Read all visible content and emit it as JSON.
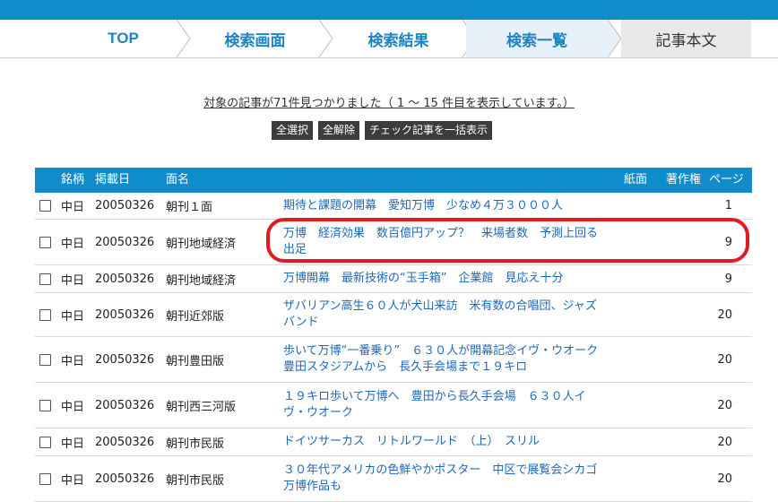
{
  "breadcrumb": {
    "items": [
      {
        "label": "TOP"
      },
      {
        "label": "検索画面"
      },
      {
        "label": "検索結果"
      },
      {
        "label": "検索一覧"
      },
      {
        "label": "記事本文"
      }
    ]
  },
  "summary": {
    "text": "対象の記事が71件見つかりました（ 1 ～ 15 件目を表示しています。）"
  },
  "buttons": {
    "select_all": "全選択",
    "clear_all": "全解除",
    "show_checked": "チェック記事を一括表示"
  },
  "table": {
    "headers": {
      "brand": "銘柄",
      "date": "掲載日",
      "edition": "面名",
      "paper_page": "紙面",
      "copyright": "著作権",
      "page": "ページ"
    },
    "rows": [
      {
        "brand": "中日",
        "date": "20050326",
        "edition": "朝刊１面",
        "title": "期待と課題の開幕　愛知万博　少なめ４万３０００人",
        "page": "1"
      },
      {
        "brand": "中日",
        "date": "20050326",
        "edition": "朝刊地域経済",
        "title": "万博　経済効果　数百億円アップ？　来場者数　予測上回る出足",
        "page": "9"
      },
      {
        "brand": "中日",
        "date": "20050326",
        "edition": "朝刊地域経済",
        "title": "万博開幕　最新技術の“玉手箱”　企業館　見応え十分",
        "page": "9"
      },
      {
        "brand": "中日",
        "date": "20050326",
        "edition": "朝刊近郊版",
        "title": "ザバリアン高生６０人が犬山来訪　米有数の合唱団、ジャズバンド",
        "page": "20"
      },
      {
        "brand": "中日",
        "date": "20050326",
        "edition": "朝刊豊田版",
        "title": "歩いて万博“一番乗り”　６３０人が開幕記念イヴ・ウオーク　豊田スタジアムから　長久手会場まで１９キロ",
        "page": "20"
      },
      {
        "brand": "中日",
        "date": "20050326",
        "edition": "朝刊西三河版",
        "title": "１９キロ歩いて万博へ　豊田から長久手会場　６３０人イヴ・ウオーク",
        "page": "20"
      },
      {
        "brand": "中日",
        "date": "20050326",
        "edition": "朝刊市民版",
        "title": "ドイツサーカス　リトルワールド　（上）　スリル",
        "page": "20"
      },
      {
        "brand": "中日",
        "date": "20050326",
        "edition": "朝刊市民版",
        "title": "３０年代アメリカの色鮮やかポスター　中区で展覧会シカゴ万博作品も",
        "page": "20"
      }
    ]
  }
}
